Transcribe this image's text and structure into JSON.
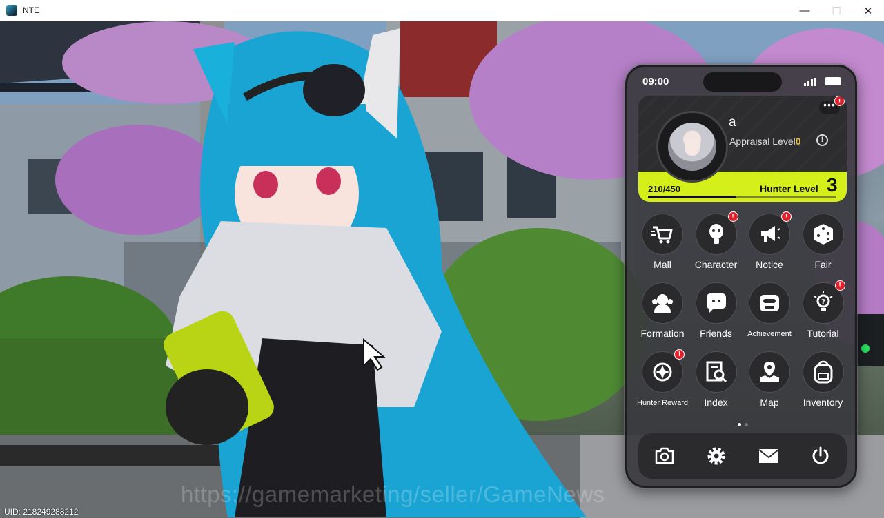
{
  "window": {
    "title": "NTE",
    "minimize": "—",
    "maximize": "☐",
    "close": "✕"
  },
  "footer": {
    "uid": "UID: 218249288212",
    "watermark": "https://gamemarketing/seller/GameNews"
  },
  "phone": {
    "status_time": "09:00",
    "profile": {
      "name": "a",
      "appraisal_label": "Appraisal Level",
      "appraisal_level": "0",
      "info_glyph": "!",
      "more_glyph": "•••",
      "more_badge": "!",
      "exp_text": "210/450",
      "exp_current": 210,
      "exp_max": 450,
      "hunter_label": "Hunter Level",
      "hunter_level": "3"
    },
    "tiles": [
      {
        "label": "Mall",
        "icon": "cart-icon",
        "badge": false
      },
      {
        "label": "Character",
        "icon": "character-icon",
        "badge": true
      },
      {
        "label": "Notice",
        "icon": "megaphone-icon",
        "badge": true
      },
      {
        "label": "Fair",
        "icon": "dice-icon",
        "badge": false
      },
      {
        "label": "Formation",
        "icon": "formation-icon",
        "badge": false
      },
      {
        "label": "Friends",
        "icon": "chat-icon",
        "badge": false
      },
      {
        "label": "Achievement",
        "icon": "achievement-icon",
        "badge": false
      },
      {
        "label": "Tutorial",
        "icon": "bulb-icon",
        "badge": true
      },
      {
        "label": "Hunter Reward",
        "icon": "crosshair-icon",
        "badge": true
      },
      {
        "label": "Index",
        "icon": "index-icon",
        "badge": false
      },
      {
        "label": "Map",
        "icon": "map-icon",
        "badge": false
      },
      {
        "label": "Inventory",
        "icon": "backpack-icon",
        "badge": false
      }
    ],
    "badge_glyph": "!",
    "dock": [
      "camera-icon",
      "settings-icon",
      "mail-icon",
      "power-icon"
    ]
  },
  "colors": {
    "level_bar": "#d4ef1a",
    "badge": "#e0202a",
    "appraisal": "#e6b93a"
  }
}
